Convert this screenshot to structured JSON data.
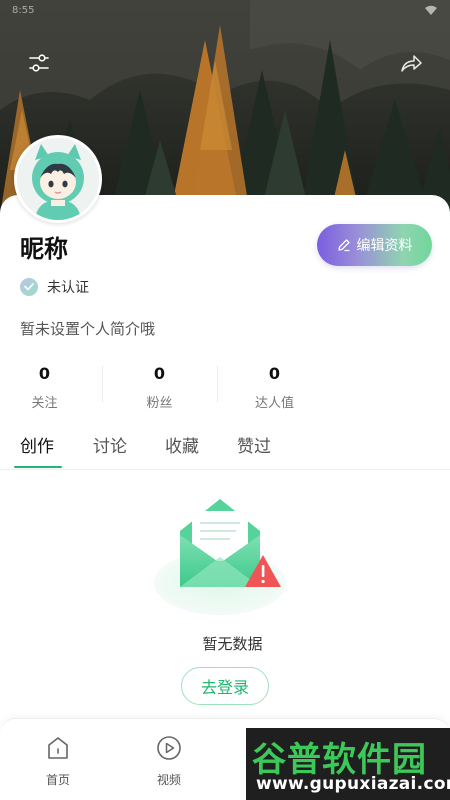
{
  "status_bar": {
    "time": "8:55"
  },
  "profile": {
    "nickname": "昵称",
    "edit_button_label": "编辑资料",
    "verification_status": "未认证",
    "bio": "暂未设置个人简介哦"
  },
  "stats": [
    {
      "value": "0",
      "label": "关注"
    },
    {
      "value": "0",
      "label": "粉丝"
    },
    {
      "value": "0",
      "label": "达人值"
    }
  ],
  "tabs": [
    {
      "label": "创作",
      "active": true
    },
    {
      "label": "讨论",
      "active": false
    },
    {
      "label": "收藏",
      "active": false
    },
    {
      "label": "赞过",
      "active": false
    }
  ],
  "empty_state": {
    "message": "暂无数据",
    "login_button_label": "去登录"
  },
  "bottom_nav": [
    {
      "label": "首页",
      "icon": "home-icon"
    },
    {
      "label": "视频",
      "icon": "play-icon"
    }
  ],
  "watermark": {
    "brand": "谷普软件园",
    "url": "www.gupuxiazai.com"
  },
  "colors": {
    "accent_green": "#22b572",
    "edit_gradient_start": "#7a5ee0",
    "edit_gradient_end": "#6fd79a",
    "warning_red": "#f05454"
  },
  "icons": {
    "settings": "sliders-icon",
    "share": "share-arrow-icon",
    "edit": "pencil-icon",
    "verify": "check-badge-icon"
  }
}
